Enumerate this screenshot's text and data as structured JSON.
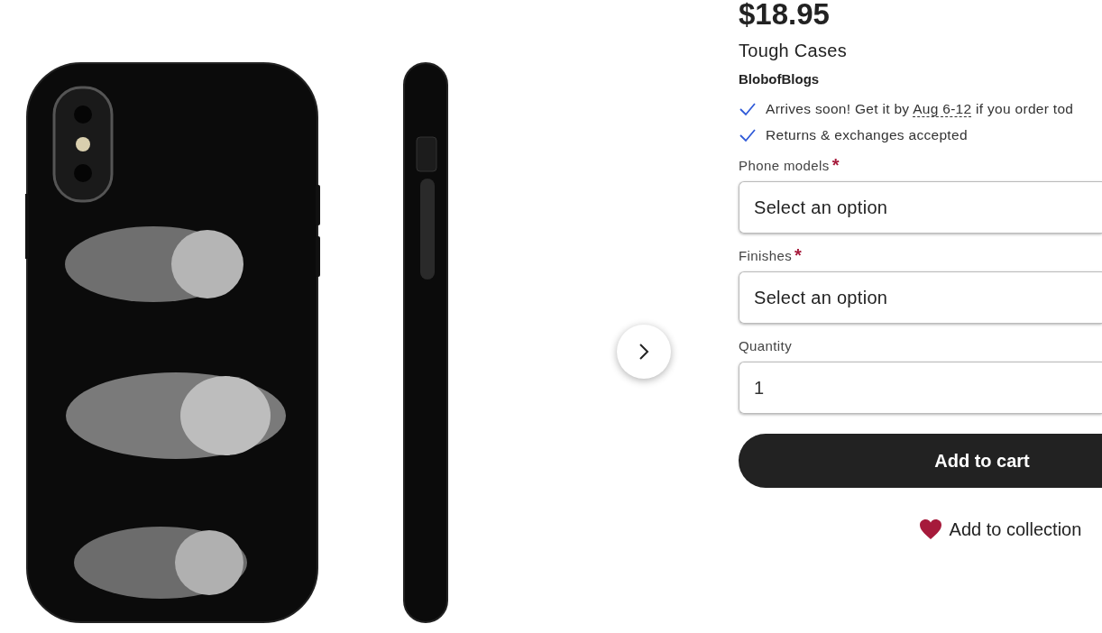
{
  "product": {
    "price": "$18.95",
    "title": "Tough Cases",
    "shop": "BlobofBlogs"
  },
  "highlights": [
    {
      "kind": "delivery",
      "before": "Arrives soon! Get it by",
      "date": "Aug 6-12",
      "after": "if you order tod"
    },
    {
      "kind": "plain",
      "text": "Returns & exchanges accepted"
    }
  ],
  "fields": [
    {
      "kind": "select",
      "label": "Phone models",
      "required": true,
      "placeholder": "Select an option"
    },
    {
      "kind": "select",
      "label": "Finishes",
      "required": true,
      "placeholder": "Select an option"
    },
    {
      "kind": "number",
      "label": "Quantity",
      "required": false,
      "value": "1"
    }
  ],
  "required_mark": "*",
  "add_to_cart": "Add to cart",
  "add_to_collection": "Add to collection"
}
